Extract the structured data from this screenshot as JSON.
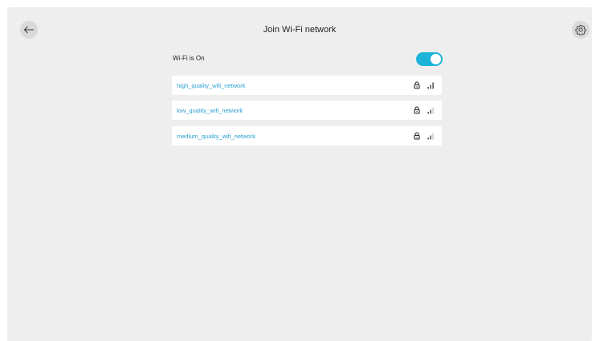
{
  "header": {
    "title": "Join Wi-Fi network",
    "back_icon": "arrow-left-icon",
    "settings_icon": "gear-icon"
  },
  "wifi": {
    "status_label": "Wi-Fi is On",
    "enabled": true,
    "accent_color": "#1bb4d8"
  },
  "networks": [
    {
      "name": "high_quality_wifi_network",
      "secured": true,
      "signal_bars": 3,
      "signal_max": 3
    },
    {
      "name": "low_quality_wifi_network",
      "secured": true,
      "signal_bars": 2,
      "signal_max": 3
    },
    {
      "name": "medium_quality_wifi_network",
      "secured": true,
      "signal_bars": 2,
      "signal_max": 3
    }
  ],
  "colors": {
    "background": "#eeeeee",
    "network_name": "#2a9fd0",
    "card": "#ffffff"
  }
}
